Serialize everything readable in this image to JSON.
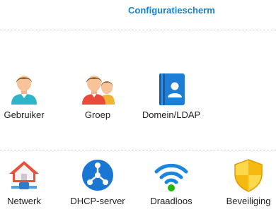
{
  "window": {
    "title": "Configuratiescherm"
  },
  "sections": [
    {
      "items": [
        {
          "label": "Gebruiker",
          "icon": "user-icon"
        },
        {
          "label": "Groep",
          "icon": "group-icon"
        },
        {
          "label": "Domein/LDAP",
          "icon": "directory-icon"
        }
      ]
    },
    {
      "items": [
        {
          "label": "Netwerk",
          "icon": "network-icon"
        },
        {
          "label": "DHCP-server",
          "icon": "dhcp-icon"
        },
        {
          "label": "Draadloos",
          "icon": "wifi-icon"
        },
        {
          "label": "Beveiliging",
          "icon": "shield-icon"
        }
      ]
    }
  ],
  "colors": {
    "title": "#1a7fd6",
    "dhcp_blue": "#1976d2",
    "directory_blue": "#1e7ed6",
    "wifi_blue": "#1a86e0",
    "wifi_green": "#1fb714",
    "shield_yellow": "#f5b90f",
    "network_red": "#e8503a"
  }
}
